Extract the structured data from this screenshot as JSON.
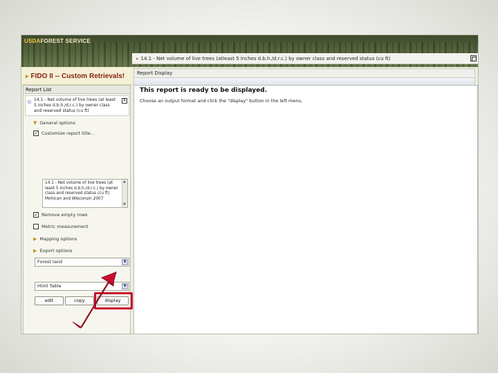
{
  "banner": {
    "logo_usda": "USDA",
    "logo_text": "FOREST SERVICE"
  },
  "title_bar": {
    "arrow": "▸",
    "text": "14.1 - Net volume of live trees (atleast 5 inches d.b.h./d.r.c.) by owner class and reserved status (cu ft)"
  },
  "app": {
    "arrow": "▸",
    "title": "FIDO II -- Custom Retrievals!"
  },
  "report_list": {
    "header": "Report List",
    "item": {
      "chevron": "⊙",
      "text": "14.1 - Net volume of live trees (at least 5 inches d.b.h./d.r.c.) by owner class and reserved status (cu ft)",
      "close": "X"
    },
    "general_options": "General options",
    "customize_label": "Customize report title...",
    "customize_checked": true,
    "description": "14.1 - Net volume of live trees (at least 5 inches d.b.h./d.r.c.) by owner class and reserved status (cu ft) Mohican and Wisconsin 2007",
    "remove_empty_rows": "Remove empty rows",
    "remove_empty_checked": true,
    "metric": "Metric measurement",
    "metric_checked": false,
    "mapping_options": "Mapping options",
    "export_options": "Export options",
    "select_land": "Forest land",
    "select_format": "Html Table",
    "buttons": {
      "edit": "edit",
      "copy": "copy",
      "display": "display"
    }
  },
  "report_display": {
    "tab": "Report Display",
    "message_title": "This report is ready to be displayed.",
    "message_body": "Choose an output format and click the \"display\" button in the left menu."
  },
  "colors": {
    "highlight": "#c8102e",
    "arrow": "#c8102e",
    "app_title": "#8a2418"
  }
}
